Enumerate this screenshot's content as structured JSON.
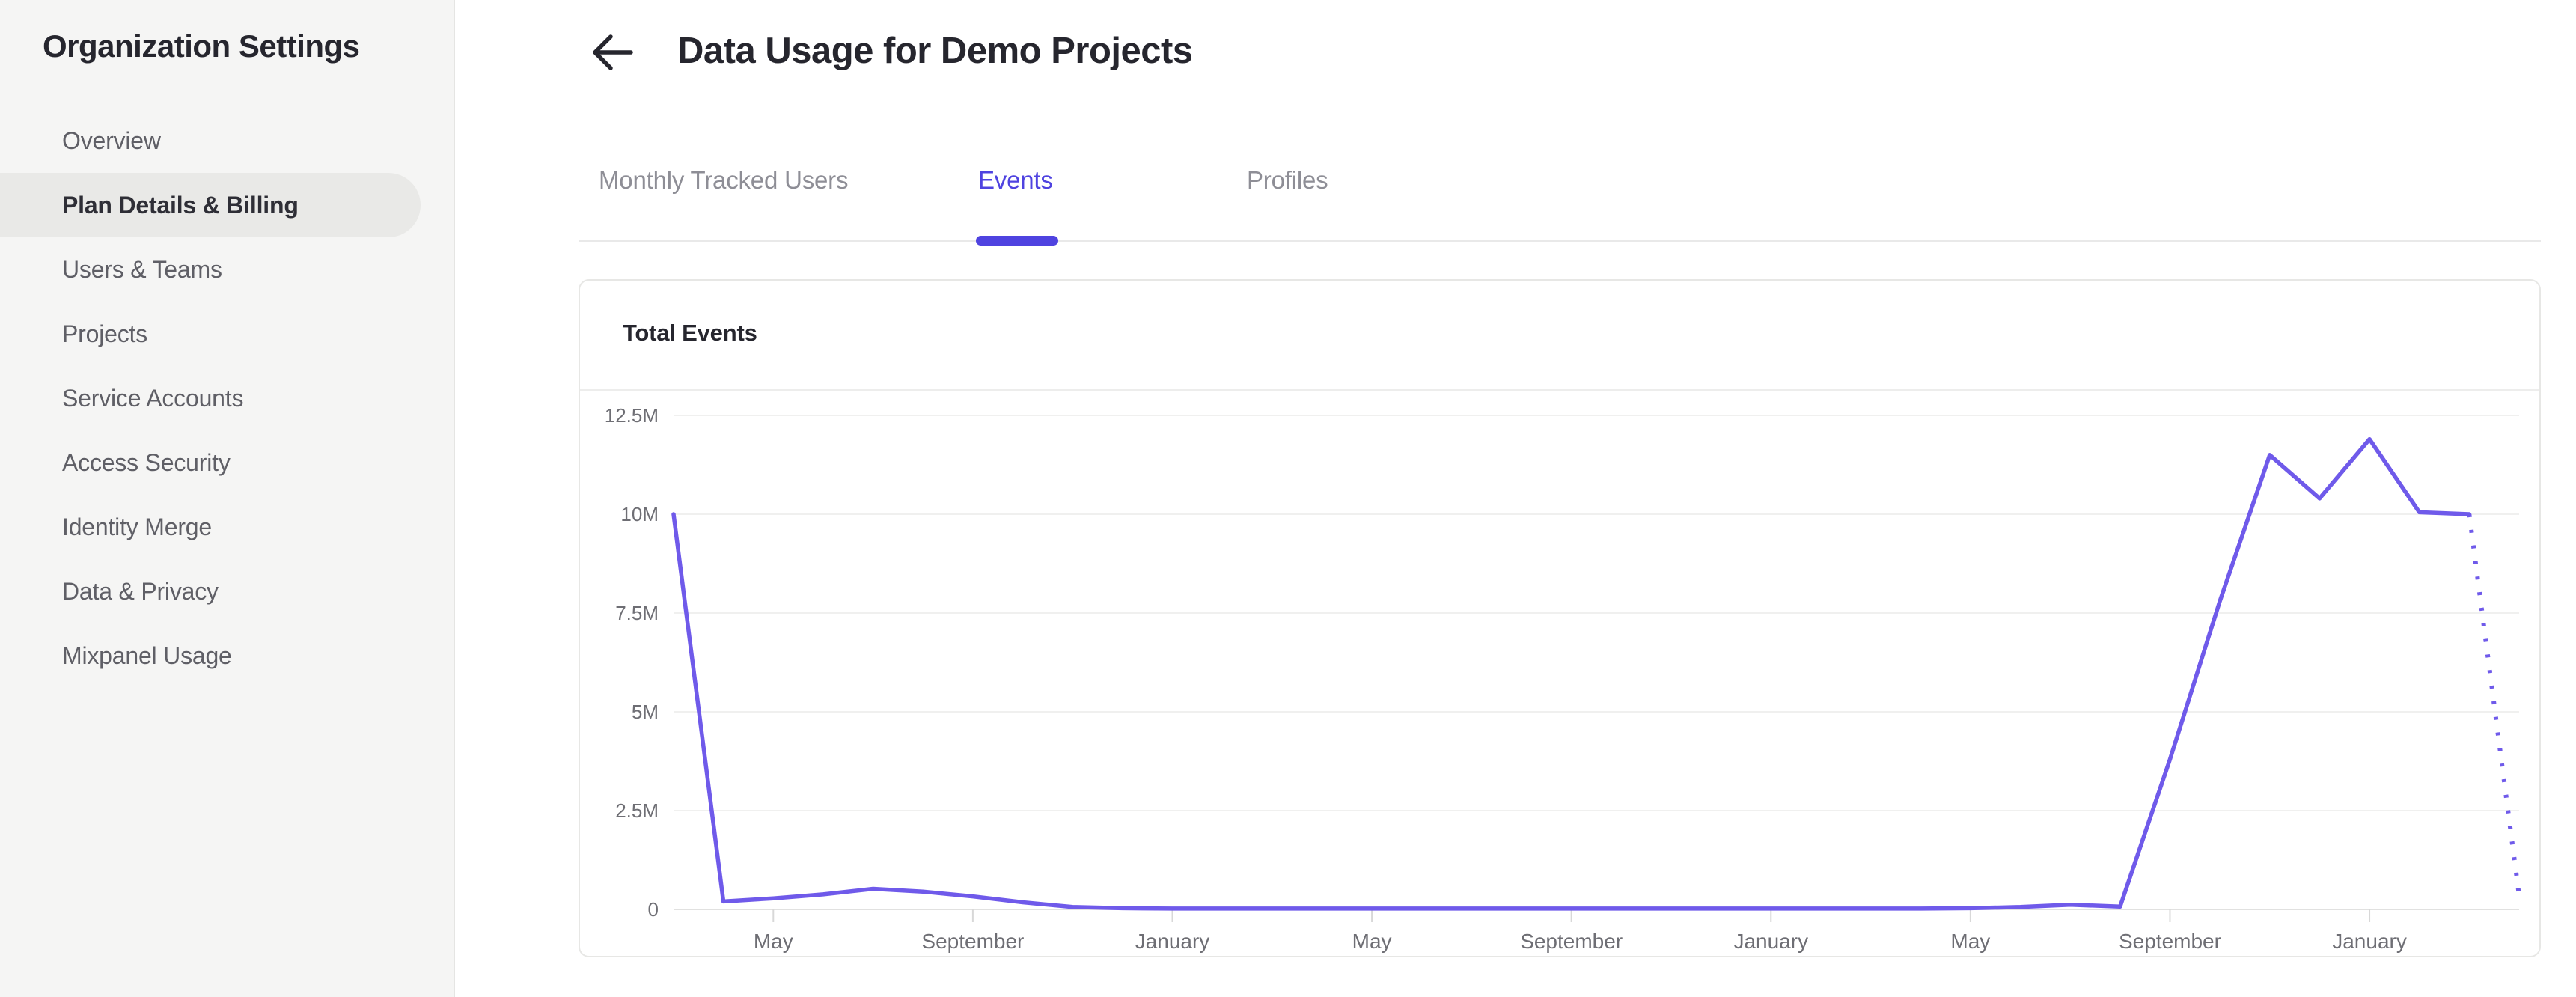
{
  "sidebar": {
    "title": "Organization Settings",
    "items": [
      {
        "label": "Overview",
        "active": false
      },
      {
        "label": "Plan Details & Billing",
        "active": true
      },
      {
        "label": "Users & Teams",
        "active": false
      },
      {
        "label": "Projects",
        "active": false
      },
      {
        "label": "Service Accounts",
        "active": false
      },
      {
        "label": "Access Security",
        "active": false
      },
      {
        "label": "Identity Merge",
        "active": false
      },
      {
        "label": "Data & Privacy",
        "active": false
      },
      {
        "label": "Mixpanel Usage",
        "active": false
      }
    ]
  },
  "header": {
    "title": "Data Usage for Demo Projects",
    "back_icon": "arrow-left"
  },
  "tabs": {
    "items": [
      {
        "label": "Monthly Tracked Users",
        "active": false
      },
      {
        "label": "Events",
        "active": true
      },
      {
        "label": "Profiles",
        "active": false
      }
    ]
  },
  "card": {
    "title": "Total Events"
  },
  "colors": {
    "accent": "#4F43E0",
    "line": "#6F5AEA",
    "grid": "#F0F0EF",
    "axis": "#E1E1E0",
    "tick": "#D8D8D8",
    "axis_text": "#6E6E74"
  },
  "chart_data": {
    "type": "line",
    "title": "Total Events",
    "legend": "none",
    "grid": "horizontal",
    "x_start_month": "March",
    "months_span": 38,
    "ylim_m": [
      0,
      12.5
    ],
    "y_ticks": [
      {
        "label": "12.5M",
        "value_m": 12.5
      },
      {
        "label": "10M",
        "value_m": 10
      },
      {
        "label": "7.5M",
        "value_m": 7.5
      },
      {
        "label": "5M",
        "value_m": 5
      },
      {
        "label": "2.5M",
        "value_m": 2.5
      },
      {
        "label": "0",
        "value_m": 0
      }
    ],
    "x_ticks": [
      {
        "label": "May",
        "month_index": 2
      },
      {
        "label": "September",
        "month_index": 6
      },
      {
        "label": "January",
        "month_index": 10
      },
      {
        "label": "May",
        "month_index": 14
      },
      {
        "label": "September",
        "month_index": 18
      },
      {
        "label": "January",
        "month_index": 22
      },
      {
        "label": "May",
        "month_index": 26
      },
      {
        "label": "September",
        "month_index": 30
      },
      {
        "label": "January",
        "month_index": 34
      }
    ],
    "values_m": [
      10,
      0.2,
      0.28,
      0.38,
      0.52,
      0.45,
      0.33,
      0.18,
      0.06,
      0.03,
      0.02,
      0.02,
      0.02,
      0.02,
      0.02,
      0.02,
      0.02,
      0.02,
      0.02,
      0.02,
      0.02,
      0.02,
      0.02,
      0.02,
      0.02,
      0.02,
      0.03,
      0.06,
      0.12,
      0.07,
      3.8,
      7.8,
      11.5,
      10.4,
      11.9,
      10.05,
      10,
      0.35
    ],
    "dotted_from_index": 36
  }
}
